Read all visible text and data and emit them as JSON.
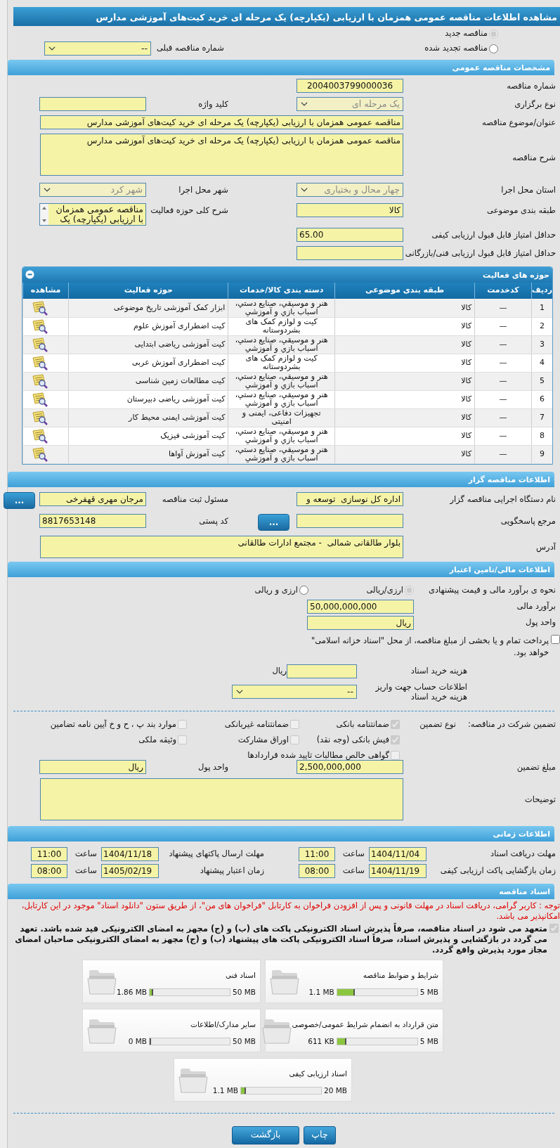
{
  "title": "مشاهده اطلاعات مناقصه عمومی همزمان با ارزیابی (یکپارچه) یک مرحله ای خرید کیت‌های آموزشی مدارس",
  "tender_type": [
    {
      "label": "مناقصه جدید",
      "selected": true
    },
    {
      "label": "مناقصه تجدید شده",
      "selected": false
    }
  ],
  "previous_tender": {
    "label": "شماره مناقصه قبلی",
    "value": "--"
  },
  "general": {
    "title": "مشخصات مناقصه عمومی",
    "rows": [
      [
        {
          "label": "شماره مناقصه",
          "kind": "text",
          "value": "2004003799000036"
        }
      ],
      [
        {
          "label": "نوع برگزاری",
          "kind": "select",
          "value": "یک مرحله ای",
          "disabled": true
        },
        {
          "label": "کلید واژه",
          "kind": "text"
        }
      ],
      [
        {
          "label": "عنوان/موضوع مناقصه",
          "kind": "longtext",
          "value": "مناقصه عمومی همزمان با ارزیابی (یکپارچه) یک مرحله ای خرید کیت‌های آموزشی مدارس"
        }
      ],
      [
        {
          "label": "شرح مناقصه",
          "kind": "textarea",
          "value": "مناقصه عمومی همزمان با ارزیابی (یکپارچه) یک مرحله ای خرید کیت‌های آموزشی مدارس"
        }
      ],
      [
        {
          "label": "استان محل اجرا",
          "kind": "select",
          "value": "چهار محال و بختیاری",
          "disabled": true
        },
        {
          "label": "شهر محل اجرا",
          "kind": "select",
          "value": "شهر کرد",
          "disabled": true
        }
      ],
      [
        {
          "label": "طبقه بندی موضوعی",
          "kind": "text",
          "value": "کالا"
        },
        {
          "label": "شرح کلی حوزه فعالیت",
          "kind": "listbox",
          "value": "مناقصه عمومی همزمان با ارزیابی (یکپارچه) یک"
        }
      ],
      [
        {
          "label": "حداقل امتیاز قابل قبول ارزیابی کیفی",
          "kind": "text",
          "value": "65.00"
        }
      ],
      [
        {
          "label": "حداقل امتیاز قابل قبول ارزیابی فنی/بازرگانی",
          "kind": "text"
        }
      ]
    ]
  },
  "activities": {
    "title": "حوزه های فعالیت",
    "columns": [
      "ردیف",
      "کدخدمت",
      "طبقه بندی موضوعی",
      "دسته بندی کالا/خدمات",
      "حوزه فعالیت",
      "مشاهده"
    ],
    "rows": [
      {
        "row": "1",
        "code": "—",
        "classification": "کالا",
        "category": "هنر و موسيقي، صنايع دستي، اسباب بازي و آموزشي",
        "activity": "ابزار کمک آموزشی تاریخ موضوعی"
      },
      {
        "row": "2",
        "code": "—",
        "classification": "کالا",
        "category": "کیت و لوازم کمک های بشردوستانه",
        "activity": "کیت اضطراری آموزش علوم"
      },
      {
        "row": "3",
        "code": "—",
        "classification": "کالا",
        "category": "هنر و موسيقي، صنايع دستي، اسباب بازي و آموزشي",
        "activity": "کیت آموزشی ریاضی ابتدایی"
      },
      {
        "row": "4",
        "code": "—",
        "classification": "کالا",
        "category": "کیت و لوازم کمک های بشردوستانه",
        "activity": "کیت اضطراری آموزش عربی"
      },
      {
        "row": "5",
        "code": "—",
        "classification": "کالا",
        "category": "هنر و موسيقي، صنايع دستي، اسباب بازي و آموزشي",
        "activity": "کیت مطالعات زمین شناسی"
      },
      {
        "row": "6",
        "code": "—",
        "classification": "کالا",
        "category": "هنر و موسيقي، صنايع دستي، اسباب بازي و آموزشي",
        "activity": "کیت آموزشی ریاضی دبیرستان"
      },
      {
        "row": "7",
        "code": "—",
        "classification": "کالا",
        "category": "تجهیزات دفاعی، ایمنی و امنیتی",
        "activity": "کیت آموزشی ایمنی محیط کار"
      },
      {
        "row": "8",
        "code": "—",
        "classification": "کالا",
        "category": "هنر و موسيقي، صنايع دستي، اسباب بازي و آموزشي",
        "activity": "کیت آموزشی فیزیک"
      },
      {
        "row": "9",
        "code": "—",
        "classification": "کالا",
        "category": "هنر و موسيقي، صنايع دستي، اسباب بازي و آموزشي",
        "activity": "کیت آموزش آواها"
      }
    ]
  },
  "tenderer": {
    "title": "اطلاعات مناقصه گزار",
    "rows": [
      [
        {
          "label": "نام دستگاه اجرایی مناقصه گزار",
          "kind": "text",
          "value": "اداره کل نوسازی  توسعه و"
        },
        {
          "label": "مسئول ثبت مناقصه",
          "kind": "text",
          "value": "مرجان مهری قهفرخی",
          "button": "..."
        }
      ],
      [
        {
          "label": "مرجع پاسخگویی",
          "kind": "text",
          "button": "..."
        },
        {
          "label": "کد پستی",
          "kind": "text",
          "value": "8817653148"
        }
      ],
      [
        {
          "label": "آدرس",
          "kind": "textarea",
          "value": "بلوار طالقانی شمالی  - مجتمع ادارات طالقانی"
        }
      ]
    ]
  },
  "finance": {
    "title": "اطلاعات مالی/تامین اعتبار",
    "method": {
      "label": "نحوه ی برآورد مالی و قیمت پیشنهادی",
      "options": [
        {
          "label": "ارزی/ریالی",
          "selected": true
        },
        {
          "label": "ارزی و ریالی",
          "selected": false
        }
      ]
    },
    "estimate": {
      "label": "برآورد مالی",
      "value": "50,000,000,000"
    },
    "currency": {
      "label": "واحد پول",
      "value": "ریال"
    },
    "treasury": {
      "label": "پرداخت تمام و یا بخشی از مبلغ مناقصه، از محل \"اسناد خزانه اسلامی\" خواهد بود.",
      "checked": false
    },
    "fee": {
      "label": "هزینه خرید اسناد",
      "unit": "ریال"
    },
    "account": {
      "label": "اطلاعات حساب جهت واریز هزینه خرید اسناد",
      "value": "--"
    }
  },
  "guarantee": {
    "label": "تضمین شرکت در مناقصه:",
    "type_label": "نوع تضمین",
    "options": [
      {
        "label": "ضمانتنامه بانکی",
        "checked": true
      },
      {
        "label": "ضمانتنامه غیربانکی",
        "checked": false
      },
      {
        "label": "موارد بند پ ، ح و خ آیین نامه تضامین",
        "checked": false
      },
      {
        "label": "فیش بانکی (وجه نقد)",
        "checked": true
      },
      {
        "label": "اوراق مشارکت",
        "checked": false
      },
      {
        "label": "وثیقه ملکی",
        "checked": false
      },
      {
        "label": "گواهی خالص مطالبات تایید شده قراردادها",
        "checked": false
      }
    ],
    "rows": [
      [
        {
          "label": "مبلغ تضمین",
          "kind": "text",
          "value": "2,500,000,000"
        },
        {
          "label": "واحد پول",
          "kind": "text",
          "value": "ریال"
        }
      ],
      [
        {
          "label": "توضیحات",
          "kind": "textarea"
        }
      ]
    ]
  },
  "timing": {
    "title": "اطلاعات زمانی",
    "rows": [
      [
        {
          "label": "مهلت دریافت اسناد",
          "date": "1404/11/04",
          "time_label": "ساعت",
          "time": "11:00"
        },
        {
          "label": "مهلت ارسال پاکتهای پیشنهاد",
          "date": "1404/11/18",
          "time_label": "ساعت",
          "time": "11:00"
        }
      ],
      [
        {
          "label": "زمان بازگشایی پاکت ارزیابی کیفی",
          "date": "1404/11/19",
          "time_label": "ساعت",
          "time": "08:00"
        },
        {
          "label": "زمان اعتبار پیشنهاد",
          "date": "1405/02/19",
          "time_label": "ساعت",
          "time": "08:00"
        }
      ]
    ]
  },
  "documents": {
    "title": "اسناد مناقصه",
    "notice": "توجه : کاربر گرامی، دریافت اسناد در مهلت قانونی و پس از افزودن فراخوان به کارتابل \"فراخوان های من\"، از طریق ستون \"دانلود اسناد\" موجود در این کارتابل، امکانپذیر می باشد.",
    "commitment": {
      "text": "متعهد می شود در اسناد مناقصه، صرفاً پذیرش اسناد الکترونیکی پاکت های (ب) و (ج) مجهز به امضای الکترونیکی قید شده باشد. تعهد می گردد در بازگشایی و پذیرش اسناد، صرفاً اسناد الکترونیکی پاکت های پیشنهاد (ب) و (ج) مجهز به امضای الکترونیکی صاحبان امضای مجاز مورد پذیرش واقع گردد.",
      "checked": true
    },
    "files": [
      {
        "name": "شرایط و ضوابط مناقصه",
        "max": "5 MB",
        "size": "1.1 MB",
        "level": 0.22
      },
      {
        "name": "اسناد فنی",
        "max": "50 MB",
        "size": "1.86 MB",
        "level": 0.04
      },
      {
        "name": "متن قرارداد به انضمام شرایط عمومی/خصوصی",
        "max": "5 MB",
        "size": "611 KB",
        "level": 0.12
      },
      {
        "name": "سایر مدارک/اطلاعات",
        "max": "50 MB",
        "size": "0 MB",
        "level": 0
      },
      {
        "name": "اسناد ارزیابی کیفی",
        "max": "20 MB",
        "size": "1.1 MB",
        "level": 0.06
      }
    ]
  },
  "buttons": [
    {
      "label": "چاپ"
    },
    {
      "label": "بازگشت"
    }
  ]
}
